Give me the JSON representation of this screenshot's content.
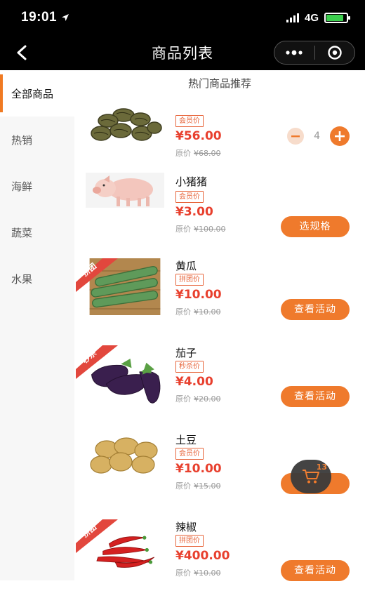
{
  "status": {
    "time": "19:01",
    "network": "4G"
  },
  "nav": {
    "title": "商品列表"
  },
  "sidebar": {
    "items": [
      {
        "label": "全部商品"
      },
      {
        "label": "热销"
      },
      {
        "label": "海鲜"
      },
      {
        "label": "蔬菜"
      },
      {
        "label": "水果"
      }
    ]
  },
  "section_title": "热门商品推荐",
  "products": [
    {
      "name": "",
      "tag": "会员价",
      "price": "¥56.00",
      "orig_label": "原价",
      "orig_price": "¥68.00",
      "quantity": "4",
      "image": "taro-image"
    },
    {
      "name": "小猪猪",
      "tag": "会员价",
      "price": "¥3.00",
      "orig_label": "原价",
      "orig_price": "¥100.00",
      "action": "选规格",
      "image": "pig-image"
    },
    {
      "name": "黄瓜",
      "tag": "拼团价",
      "price": "¥10.00",
      "orig_label": "原价",
      "orig_price": "¥10.00",
      "action": "查看活动",
      "badge": "拼团",
      "image": "cucumber-image"
    },
    {
      "name": "茄子",
      "tag": "秒杀价",
      "price": "¥4.00",
      "orig_label": "原价",
      "orig_price": "¥20.00",
      "action": "查看活动",
      "badge": "秒杀",
      "image": "eggplant-image"
    },
    {
      "name": "土豆",
      "tag": "会员价",
      "price": "¥10.00",
      "orig_label": "原价",
      "orig_price": "¥15.00",
      "action": "",
      "image": "potato-image"
    },
    {
      "name": "辣椒",
      "tag": "拼团价",
      "price": "¥400.00",
      "orig_label": "原价",
      "orig_price": "¥10.00",
      "action": "查看活动",
      "badge": "拼团",
      "image": "chili-image"
    }
  ],
  "cart": {
    "count": "13"
  },
  "colors": {
    "accent": "#ef7a2c",
    "price": "#e8402e",
    "badge": "#e2473d"
  }
}
